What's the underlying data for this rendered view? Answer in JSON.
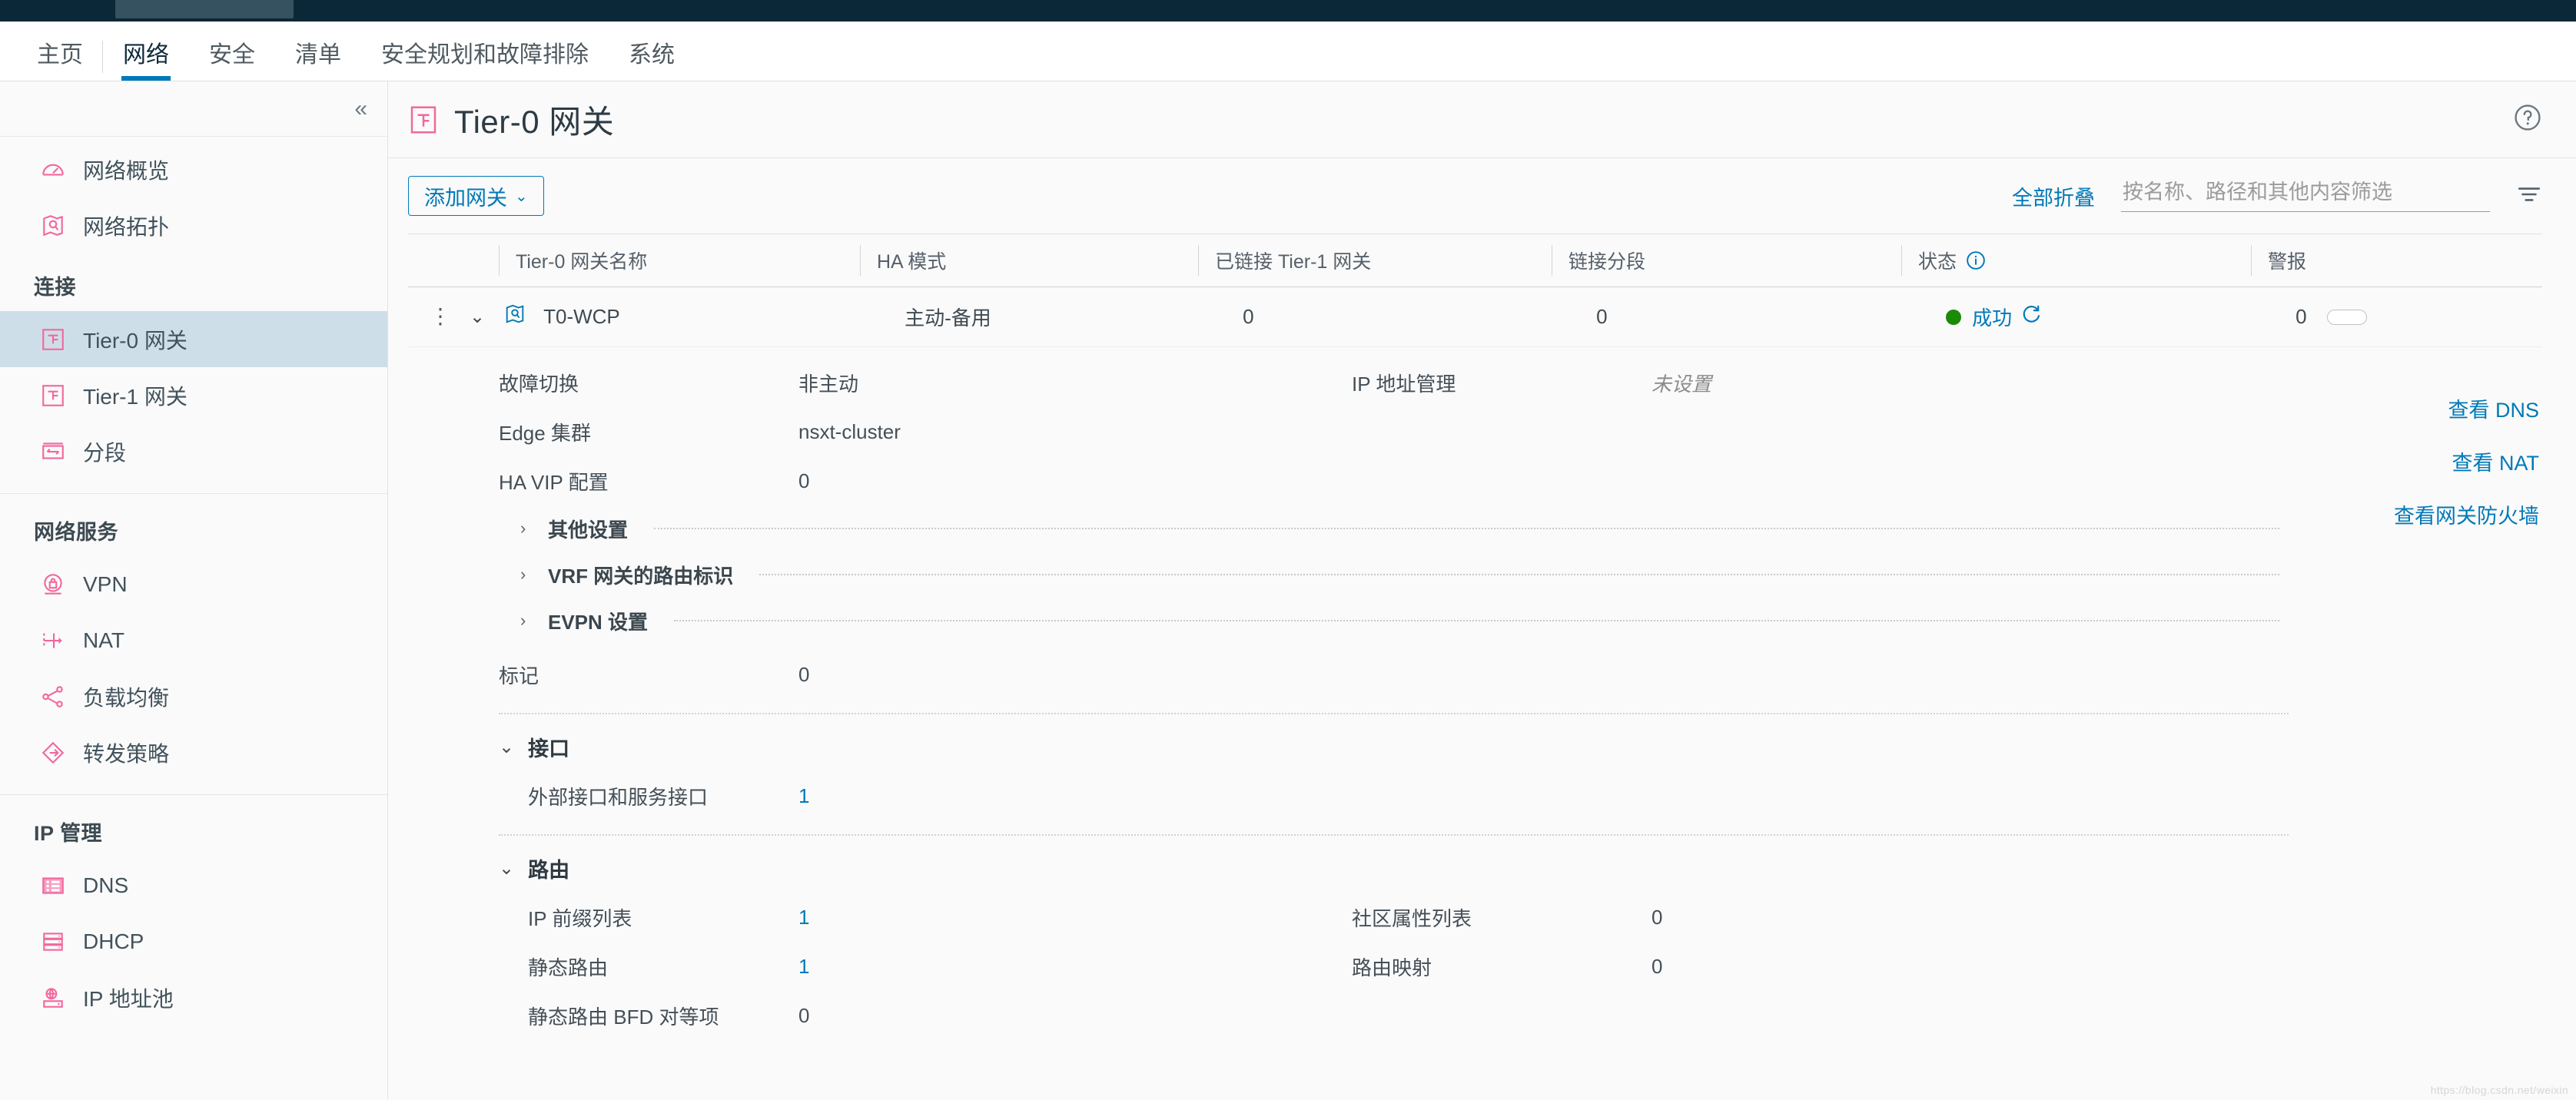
{
  "topnav": {
    "items": [
      {
        "label": "主页",
        "active": false
      },
      {
        "label": "网络",
        "active": true
      },
      {
        "label": "安全",
        "active": false
      },
      {
        "label": "清单",
        "active": false
      },
      {
        "label": "安全规划和故障排除",
        "active": false
      },
      {
        "label": "系统",
        "active": false
      }
    ]
  },
  "sidebar": {
    "collapse_icon": "«",
    "top_items": [
      {
        "label": "网络概览",
        "icon": "dashboard-icon"
      },
      {
        "label": "网络拓扑",
        "icon": "topology-map-icon"
      }
    ],
    "groups": [
      {
        "title": "连接",
        "items": [
          {
            "label": "Tier-0 网关",
            "icon": "tier-gateway-icon",
            "active": true
          },
          {
            "label": "Tier-1 网关",
            "icon": "tier-gateway-icon",
            "active": false
          },
          {
            "label": "分段",
            "icon": "segment-icon",
            "active": false
          }
        ]
      },
      {
        "title": "网络服务",
        "items": [
          {
            "label": "VPN",
            "icon": "vpn-lock-icon",
            "active": false
          },
          {
            "label": "NAT",
            "icon": "nat-icon",
            "active": false
          },
          {
            "label": "负载均衡",
            "icon": "load-balancer-icon",
            "active": false
          },
          {
            "label": "转发策略",
            "icon": "forwarding-policy-icon",
            "active": false
          }
        ]
      },
      {
        "title": "IP 管理",
        "items": [
          {
            "label": "DNS",
            "icon": "dns-icon",
            "active": false
          },
          {
            "label": "DHCP",
            "icon": "dhcp-server-icon",
            "active": false
          },
          {
            "label": "IP 地址池",
            "icon": "ip-pool-icon",
            "active": false
          }
        ]
      }
    ]
  },
  "page": {
    "title": "Tier-0 网关",
    "title_icon": "tier-gateway-icon",
    "help_icon": "help-circle-icon"
  },
  "toolbar": {
    "add_gateway_label": "添加网关",
    "add_gateway_caret": "⌄",
    "collapse_all_label": "全部折叠",
    "search_placeholder": "按名称、路径和其他内容筛选",
    "search_value": "",
    "filter_icon": "filter-icon"
  },
  "table": {
    "columns": [
      {
        "label": ""
      },
      {
        "label": "Tier-0 网关名称"
      },
      {
        "label": "HA 模式"
      },
      {
        "label": "已链接 Tier-1 网关"
      },
      {
        "label": "链接分段"
      },
      {
        "label": "状态",
        "info_icon": "info-circle-icon"
      },
      {
        "label": "警报"
      }
    ],
    "row": {
      "menu_icon": "kebab-menu-icon",
      "expand_icon": "chevron-down-icon",
      "topology_icon": "topology-map-icon",
      "name": "T0-WCP",
      "ha_mode": "主动-备用",
      "linked_tier1": "0",
      "linked_segments": "0",
      "status_text": "成功",
      "status_color": "#1b8a06",
      "refresh_icon": "refresh-icon",
      "alarms": "0"
    }
  },
  "detail": {
    "fields": [
      {
        "label": "故障切换",
        "value": "非主动",
        "right_label": "IP 地址管理",
        "right_value": "未设置",
        "right_muted": true
      },
      {
        "label": "Edge 集群",
        "value": "nsxt-cluster",
        "right_label": "",
        "right_value": ""
      },
      {
        "label": "HA VIP 配置",
        "value": "0",
        "right_label": "",
        "right_value": ""
      }
    ],
    "accordions": [
      {
        "label": "其他设置",
        "caret": "›"
      },
      {
        "label": "VRF 网关的路由标识",
        "caret": "›"
      },
      {
        "label": "EVPN 设置",
        "caret": "›"
      }
    ],
    "tags": {
      "label": "标记",
      "value": "0"
    },
    "links": [
      {
        "label": "查看 DNS"
      },
      {
        "label": "查看 NAT"
      },
      {
        "label": "查看网关防火墙"
      }
    ],
    "sections": [
      {
        "title": "接口",
        "caret": "⌄",
        "rows": [
          {
            "label": "外部接口和服务接口",
            "value": "1",
            "link": true,
            "right_label": "",
            "right_value": ""
          }
        ]
      },
      {
        "title": "路由",
        "caret": "⌄",
        "rows": [
          {
            "label": "IP 前缀列表",
            "value": "1",
            "link": true,
            "right_label": "社区属性列表",
            "right_value": "0",
            "right_link": false
          },
          {
            "label": "静态路由",
            "value": "1",
            "link": true,
            "right_label": "路由映射",
            "right_value": "0",
            "right_link": false
          },
          {
            "label": "静态路由 BFD 对等项",
            "value": "0",
            "link": false,
            "right_label": "",
            "right_value": ""
          }
        ]
      }
    ]
  },
  "watermark": "https://blog.csdn.net/weixin",
  "colors": {
    "accent_blue": "#0079b8",
    "icon_pink": "#f2689d",
    "status_green": "#1b8a06",
    "sidebar_active": "#cedee9"
  }
}
